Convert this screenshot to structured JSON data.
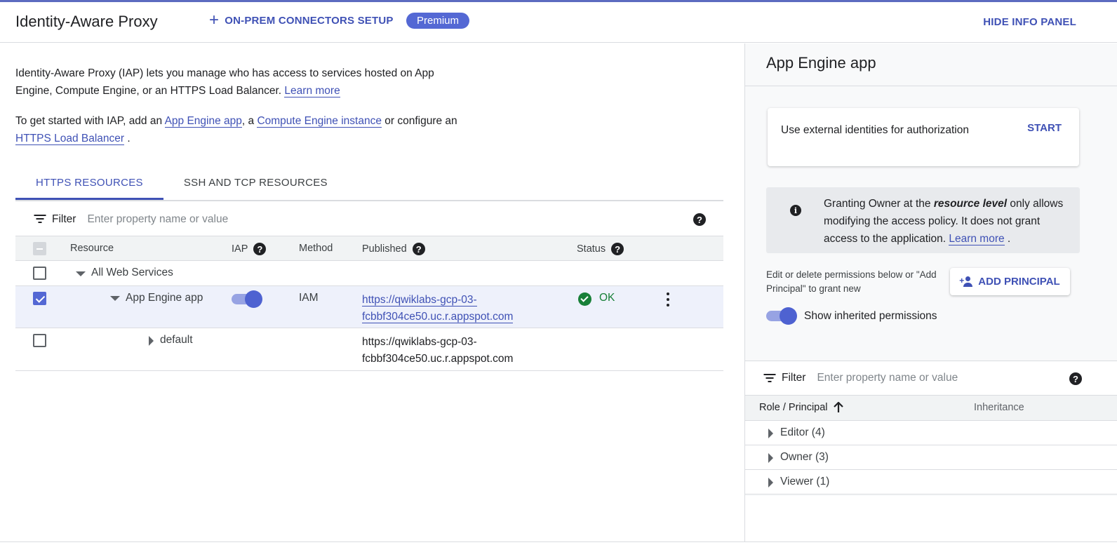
{
  "header": {
    "title": "Identity-Aware Proxy",
    "connectors_label": "ON-PREM CONNECTORS SETUP",
    "premium_badge": "Premium",
    "hide_panel_label": "HIDE INFO PANEL"
  },
  "intro": {
    "p1_text": "Identity-Aware Proxy (IAP) lets you manage who has access to services hosted on App Engine, Compute Engine, or an HTTPS Load Balancer. ",
    "p1_link": "Learn more",
    "p2_prefix": "To get started with IAP, add an ",
    "p2_link1": "App Engine app",
    "p2_mid1": ", a ",
    "p2_link2": "Compute Engine instance",
    "p2_mid2": " or configure an ",
    "p2_link3": "HTTPS Load Balancer",
    "p2_suffix": " ."
  },
  "tabs": [
    {
      "label": "HTTPS RESOURCES"
    },
    {
      "label": "SSH AND TCP RESOURCES"
    }
  ],
  "filter": {
    "label": "Filter",
    "placeholder": "Enter property name or value"
  },
  "table": {
    "columns": {
      "resource": "Resource",
      "iap": "IAP",
      "method": "Method",
      "published": "Published",
      "status": "Status"
    },
    "rows": [
      {
        "resource": "All Web Services"
      },
      {
        "resource": "App Engine app",
        "method": "IAM",
        "published_line1": "https://qwiklabs-gcp-03-",
        "published_line2": "fcbbf304ce50.uc.r.appspot.com",
        "status": "OK"
      },
      {
        "resource": "default",
        "published_line1": "https://qwiklabs-gcp-03-",
        "published_line2": "fcbbf304ce50.uc.r.appspot.com"
      }
    ]
  },
  "side": {
    "title": "App Engine app",
    "card_text": "Use external identities for authorization",
    "card_start": "START",
    "info_part1": "Granting Owner at the ",
    "info_emph": "resource level",
    "info_part2": " only allows modifying the access policy. It does not grant access to the application. ",
    "info_link": "Learn more",
    "info_end": " .",
    "edit_text": "Edit or delete permissions below or \"Add Principal\" to grant new",
    "add_principal": "ADD PRINCIPAL",
    "inherit_label": "Show inherited permissions",
    "filter_label": "Filter",
    "filter_placeholder": "Enter property name or value",
    "col_role": "Role / Principal",
    "col_inheritance": "Inheritance",
    "roles": [
      {
        "label": "Editor (4)"
      },
      {
        "label": "Owner (3)"
      },
      {
        "label": "Viewer (1)"
      }
    ]
  },
  "colors": {
    "accent": "#3f51b5",
    "premium": "#5468d4",
    "ok": "#188038"
  },
  "icons": [
    "plus-icon",
    "filter-icon",
    "help-icon",
    "caret-down-icon",
    "caret-right-icon",
    "check-circle-icon",
    "more-vert-icon",
    "info-icon",
    "person-add-icon",
    "arrow-up-icon"
  ]
}
